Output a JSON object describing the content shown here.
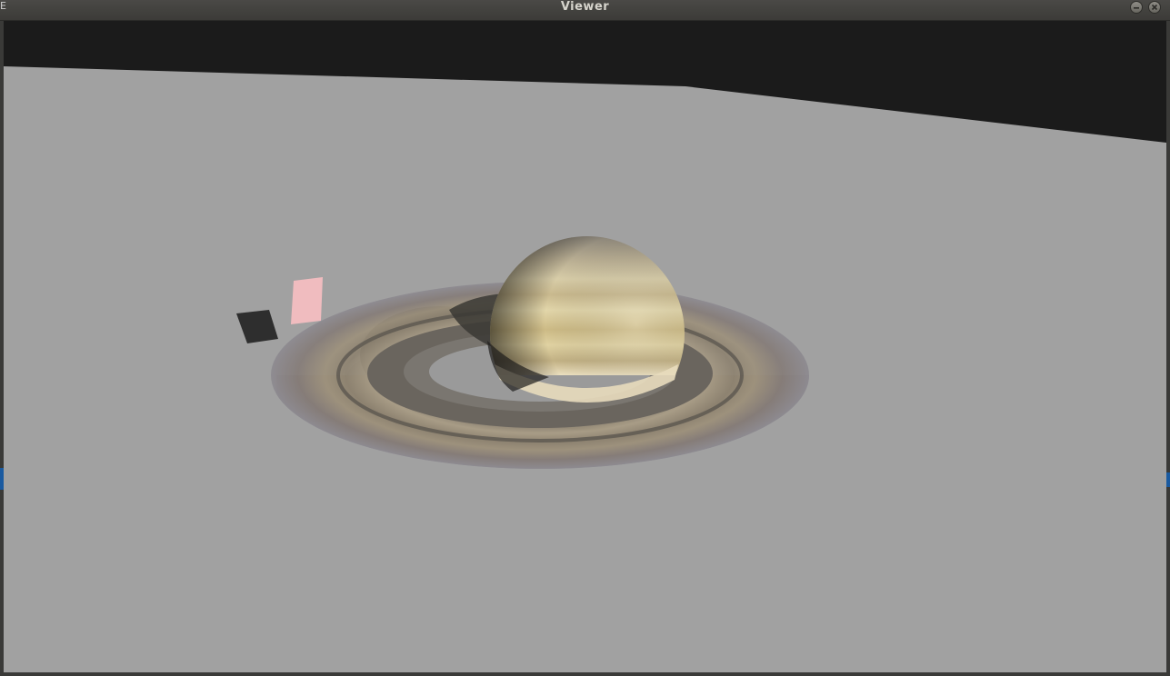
{
  "window": {
    "title": "Viewer",
    "edge_glyph": "E"
  },
  "controls": {
    "minimize": "minimize-icon",
    "close": "close-icon"
  },
  "scene": {
    "background_color": "#1b1b1b",
    "ground_color": "#a1a1a1",
    "planet": "Saturn",
    "objects": [
      {
        "name": "dark-panel",
        "color": "#2e2e2e"
      },
      {
        "name": "pink-panel",
        "color": "#f0bcbf"
      }
    ]
  },
  "colors": {
    "titlebar": "#3c3b38",
    "accent": "#1a5aa0"
  }
}
